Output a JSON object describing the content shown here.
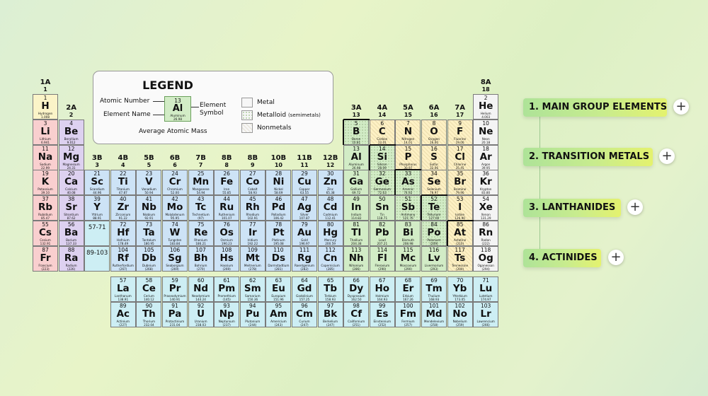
{
  "legend": {
    "title": "LEGEND",
    "atomic_number_label": "Atomic Number",
    "element_name_label": "Element Name",
    "element_symbol_label_1": "Element",
    "element_symbol_label_2": "Symbol",
    "average_mass_label": "Average Atomic Mass",
    "sample": {
      "number": "13",
      "symbol": "Al",
      "name": "Aluminum",
      "mass": "26.98"
    },
    "types": [
      {
        "label": "Metal",
        "note": ""
      },
      {
        "label": "Metalloid",
        "note": "(semimetals)"
      },
      {
        "label": "Nonmetals",
        "note": ""
      }
    ]
  },
  "menu": [
    {
      "label": "1. MAIN GROUP ELEMENTS"
    },
    {
      "label": "2. TRANSITION METALS"
    },
    {
      "label": "3. LANTHANIDES"
    },
    {
      "label": "4. ACTINIDES"
    }
  ],
  "plus_symbol": "+",
  "groups": [
    {
      "a": "1A",
      "n": "1",
      "col": 1
    },
    {
      "a": "2A",
      "n": "2",
      "col": 2
    },
    {
      "a": "3B",
      "n": "3",
      "col": 3
    },
    {
      "a": "4B",
      "n": "4",
      "col": 4
    },
    {
      "a": "5B",
      "n": "5",
      "col": 5
    },
    {
      "a": "6B",
      "n": "6",
      "col": 6
    },
    {
      "a": "7B",
      "n": "7",
      "col": 7
    },
    {
      "a": "8B",
      "n": "8",
      "col": 8
    },
    {
      "a": "8B",
      "n": "9",
      "col": 9
    },
    {
      "a": "10B",
      "n": "10",
      "col": 10
    },
    {
      "a": "11B",
      "n": "11",
      "col": 11
    },
    {
      "a": "12B",
      "n": "12",
      "col": 12
    },
    {
      "a": "3A",
      "n": "13",
      "col": 13
    },
    {
      "a": "4A",
      "n": "14",
      "col": 14
    },
    {
      "a": "5A",
      "n": "15",
      "col": 15
    },
    {
      "a": "6A",
      "n": "16",
      "col": 16
    },
    {
      "a": "7A",
      "n": "17",
      "col": 17
    },
    {
      "a": "8A",
      "n": "18",
      "col": 18
    }
  ],
  "placeholders": [
    {
      "label": "57-71",
      "row": 6,
      "col": 3
    },
    {
      "label": "89-103",
      "row": 7,
      "col": 3
    }
  ],
  "elements": [
    {
      "n": "1",
      "s": "H",
      "name": "Hydrogen",
      "m": "1.008",
      "r": 1,
      "c": 1,
      "cat": "h"
    },
    {
      "n": "2",
      "s": "He",
      "name": "Helium",
      "m": "4.003",
      "r": 1,
      "c": 18,
      "cat": "noble"
    },
    {
      "n": "3",
      "s": "Li",
      "name": "Lithium",
      "m": "6.941",
      "r": 2,
      "c": 1,
      "cat": "alkali"
    },
    {
      "n": "4",
      "s": "Be",
      "name": "Beryllium",
      "m": "9.012",
      "r": 2,
      "c": 2,
      "cat": "alkaline"
    },
    {
      "n": "5",
      "s": "B",
      "name": "Boron",
      "m": "10.81",
      "r": 2,
      "c": 13,
      "cat": "metalloid"
    },
    {
      "n": "6",
      "s": "C",
      "name": "Carbon",
      "m": "12.01",
      "r": 2,
      "c": 14,
      "cat": "nonmetal"
    },
    {
      "n": "7",
      "s": "N",
      "name": "Nitrogen",
      "m": "14.01",
      "r": 2,
      "c": 15,
      "cat": "nonmetal"
    },
    {
      "n": "8",
      "s": "O",
      "name": "Oxygen",
      "m": "16.00",
      "r": 2,
      "c": 16,
      "cat": "nonmetal"
    },
    {
      "n": "9",
      "s": "F",
      "name": "Fluorine",
      "m": "19.00",
      "r": 2,
      "c": 17,
      "cat": "nonmetal"
    },
    {
      "n": "10",
      "s": "Ne",
      "name": "Neon",
      "m": "20.18",
      "r": 2,
      "c": 18,
      "cat": "noble"
    },
    {
      "n": "11",
      "s": "Na",
      "name": "Sodium",
      "m": "22.99",
      "r": 3,
      "c": 1,
      "cat": "alkali"
    },
    {
      "n": "12",
      "s": "Mg",
      "name": "Magnesium",
      "m": "24.31",
      "r": 3,
      "c": 2,
      "cat": "alkaline"
    },
    {
      "n": "13",
      "s": "Al",
      "name": "Aluminum",
      "m": "26.98",
      "r": 3,
      "c": 13,
      "cat": "post"
    },
    {
      "n": "14",
      "s": "Si",
      "name": "Silicon",
      "m": "28.09",
      "r": 3,
      "c": 14,
      "cat": "metalloid"
    },
    {
      "n": "15",
      "s": "P",
      "name": "Phosphorus",
      "m": "30.97",
      "r": 3,
      "c": 15,
      "cat": "nonmetal"
    },
    {
      "n": "16",
      "s": "S",
      "name": "Sulfur",
      "m": "32.06",
      "r": 3,
      "c": 16,
      "cat": "nonmetal"
    },
    {
      "n": "17",
      "s": "Cl",
      "name": "Chlorine",
      "m": "35.45",
      "r": 3,
      "c": 17,
      "cat": "nonmetal"
    },
    {
      "n": "18",
      "s": "Ar",
      "name": "Argon",
      "m": "39.95",
      "r": 3,
      "c": 18,
      "cat": "noble"
    },
    {
      "n": "19",
      "s": "K",
      "name": "Potassium",
      "m": "39.10",
      "r": 4,
      "c": 1,
      "cat": "alkali"
    },
    {
      "n": "20",
      "s": "Ca",
      "name": "Calcium",
      "m": "40.08",
      "r": 4,
      "c": 2,
      "cat": "alkaline"
    },
    {
      "n": "21",
      "s": "Sc",
      "name": "Scandium",
      "m": "44.96",
      "r": 4,
      "c": 3,
      "cat": "transition"
    },
    {
      "n": "22",
      "s": "Ti",
      "name": "Titanium",
      "m": "47.87",
      "r": 4,
      "c": 4,
      "cat": "transition"
    },
    {
      "n": "23",
      "s": "V",
      "name": "Vanadium",
      "m": "50.94",
      "r": 4,
      "c": 5,
      "cat": "transition"
    },
    {
      "n": "24",
      "s": "Cr",
      "name": "Chromium",
      "m": "52.00",
      "r": 4,
      "c": 6,
      "cat": "transition"
    },
    {
      "n": "25",
      "s": "Mn",
      "name": "Manganese",
      "m": "54.94",
      "r": 4,
      "c": 7,
      "cat": "transition"
    },
    {
      "n": "26",
      "s": "Fe",
      "name": "Iron",
      "m": "55.85",
      "r": 4,
      "c": 8,
      "cat": "transition"
    },
    {
      "n": "27",
      "s": "Co",
      "name": "Cobalt",
      "m": "58.93",
      "r": 4,
      "c": 9,
      "cat": "transition"
    },
    {
      "n": "28",
      "s": "Ni",
      "name": "Nickel",
      "m": "58.69",
      "r": 4,
      "c": 10,
      "cat": "transition"
    },
    {
      "n": "29",
      "s": "Cu",
      "name": "Copper",
      "m": "63.55",
      "r": 4,
      "c": 11,
      "cat": "transition"
    },
    {
      "n": "30",
      "s": "Zn",
      "name": "Zinc",
      "m": "65.38",
      "r": 4,
      "c": 12,
      "cat": "transition"
    },
    {
      "n": "31",
      "s": "Ga",
      "name": "Gallium",
      "m": "69.72",
      "r": 4,
      "c": 13,
      "cat": "post"
    },
    {
      "n": "32",
      "s": "Ge",
      "name": "Germanium",
      "m": "72.63",
      "r": 4,
      "c": 14,
      "cat": "metalloid"
    },
    {
      "n": "33",
      "s": "As",
      "name": "Arsenic",
      "m": "74.92",
      "r": 4,
      "c": 15,
      "cat": "metalloid"
    },
    {
      "n": "34",
      "s": "Se",
      "name": "Selenium",
      "m": "78.97",
      "r": 4,
      "c": 16,
      "cat": "nonmetal"
    },
    {
      "n": "35",
      "s": "Br",
      "name": "Bromine",
      "m": "79.90",
      "r": 4,
      "c": 17,
      "cat": "nonmetal"
    },
    {
      "n": "36",
      "s": "Kr",
      "name": "Krypton",
      "m": "83.80",
      "r": 4,
      "c": 18,
      "cat": "noble"
    },
    {
      "n": "37",
      "s": "Rb",
      "name": "Rubidium",
      "m": "85.47",
      "r": 5,
      "c": 1,
      "cat": "alkali"
    },
    {
      "n": "38",
      "s": "Sr",
      "name": "Strontium",
      "m": "87.62",
      "r": 5,
      "c": 2,
      "cat": "alkaline"
    },
    {
      "n": "39",
      "s": "Y",
      "name": "Yttrium",
      "m": "88.91",
      "r": 5,
      "c": 3,
      "cat": "transition"
    },
    {
      "n": "40",
      "s": "Zr",
      "name": "Zirconium",
      "m": "91.22",
      "r": 5,
      "c": 4,
      "cat": "transition"
    },
    {
      "n": "41",
      "s": "Nb",
      "name": "Niobium",
      "m": "92.91",
      "r": 5,
      "c": 5,
      "cat": "transition"
    },
    {
      "n": "42",
      "s": "Mo",
      "name": "Molybdenum",
      "m": "95.95",
      "r": 5,
      "c": 6,
      "cat": "transition"
    },
    {
      "n": "43",
      "s": "Tc",
      "name": "Technetium",
      "m": "(97)",
      "r": 5,
      "c": 7,
      "cat": "transition"
    },
    {
      "n": "44",
      "s": "Ru",
      "name": "Ruthenium",
      "m": "101.07",
      "r": 5,
      "c": 8,
      "cat": "transition"
    },
    {
      "n": "45",
      "s": "Rh",
      "name": "Rhodium",
      "m": "102.91",
      "r": 5,
      "c": 9,
      "cat": "transition"
    },
    {
      "n": "46",
      "s": "Pd",
      "name": "Palladium",
      "m": "106.42",
      "r": 5,
      "c": 10,
      "cat": "transition"
    },
    {
      "n": "47",
      "s": "Ag",
      "name": "Silver",
      "m": "107.87",
      "r": 5,
      "c": 11,
      "cat": "transition"
    },
    {
      "n": "48",
      "s": "Cd",
      "name": "Cadmium",
      "m": "112.41",
      "r": 5,
      "c": 12,
      "cat": "transition"
    },
    {
      "n": "49",
      "s": "In",
      "name": "Indium",
      "m": "114.82",
      "r": 5,
      "c": 13,
      "cat": "post"
    },
    {
      "n": "50",
      "s": "Sn",
      "name": "Tin",
      "m": "118.71",
      "r": 5,
      "c": 14,
      "cat": "post"
    },
    {
      "n": "51",
      "s": "Sb",
      "name": "Antimony",
      "m": "121.76",
      "r": 5,
      "c": 15,
      "cat": "metalloid"
    },
    {
      "n": "52",
      "s": "Te",
      "name": "Tellurium",
      "m": "127.60",
      "r": 5,
      "c": 16,
      "cat": "metalloid"
    },
    {
      "n": "53",
      "s": "I",
      "name": "Iodine",
      "m": "126.90",
      "r": 5,
      "c": 17,
      "cat": "nonmetal"
    },
    {
      "n": "54",
      "s": "Xe",
      "name": "Xenon",
      "m": "131.29",
      "r": 5,
      "c": 18,
      "cat": "noble"
    },
    {
      "n": "55",
      "s": "Cs",
      "name": "Cesium",
      "m": "132.91",
      "r": 6,
      "c": 1,
      "cat": "alkali"
    },
    {
      "n": "56",
      "s": "Ba",
      "name": "Barium",
      "m": "137.33",
      "r": 6,
      "c": 2,
      "cat": "alkaline"
    },
    {
      "n": "72",
      "s": "Hf",
      "name": "Hafnium",
      "m": "178.49",
      "r": 6,
      "c": 4,
      "cat": "transition"
    },
    {
      "n": "73",
      "s": "Ta",
      "name": "Tantalum",
      "m": "180.95",
      "r": 6,
      "c": 5,
      "cat": "transition"
    },
    {
      "n": "74",
      "s": "W",
      "name": "Tungsten",
      "m": "183.84",
      "r": 6,
      "c": 6,
      "cat": "transition"
    },
    {
      "n": "75",
      "s": "Re",
      "name": "Rhenium",
      "m": "186.21",
      "r": 6,
      "c": 7,
      "cat": "transition"
    },
    {
      "n": "76",
      "s": "Os",
      "name": "Osmium",
      "m": "190.23",
      "r": 6,
      "c": 8,
      "cat": "transition"
    },
    {
      "n": "77",
      "s": "Ir",
      "name": "Iridium",
      "m": "192.22",
      "r": 6,
      "c": 9,
      "cat": "transition"
    },
    {
      "n": "78",
      "s": "Pt",
      "name": "Platinum",
      "m": "195.08",
      "r": 6,
      "c": 10,
      "cat": "transition"
    },
    {
      "n": "79",
      "s": "Au",
      "name": "Gold",
      "m": "196.97",
      "r": 6,
      "c": 11,
      "cat": "transition"
    },
    {
      "n": "80",
      "s": "Hg",
      "name": "Mercury",
      "m": "200.59",
      "r": 6,
      "c": 12,
      "cat": "transition"
    },
    {
      "n": "81",
      "s": "Tl",
      "name": "Thallium",
      "m": "204.38",
      "r": 6,
      "c": 13,
      "cat": "post"
    },
    {
      "n": "82",
      "s": "Pb",
      "name": "Lead",
      "m": "207.21",
      "r": 6,
      "c": 14,
      "cat": "post"
    },
    {
      "n": "83",
      "s": "Bi",
      "name": "Bismuth",
      "m": "208.98",
      "r": 6,
      "c": 15,
      "cat": "post"
    },
    {
      "n": "84",
      "s": "Po",
      "name": "Polonium",
      "m": "(209)",
      "r": 6,
      "c": 16,
      "cat": "metalloid"
    },
    {
      "n": "85",
      "s": "At",
      "name": "Astatine",
      "m": "(210)",
      "r": 6,
      "c": 17,
      "cat": "nonmetal"
    },
    {
      "n": "86",
      "s": "Rn",
      "name": "Radon",
      "m": "(222)",
      "r": 6,
      "c": 18,
      "cat": "noble"
    },
    {
      "n": "87",
      "s": "Fr",
      "name": "Francium",
      "m": "(223)",
      "r": 7,
      "c": 1,
      "cat": "alkali"
    },
    {
      "n": "88",
      "s": "Ra",
      "name": "Radium",
      "m": "(226)",
      "r": 7,
      "c": 2,
      "cat": "alkaline"
    },
    {
      "n": "104",
      "s": "Rf",
      "name": "Rutherfordium",
      "m": "(267)",
      "r": 7,
      "c": 4,
      "cat": "transition"
    },
    {
      "n": "105",
      "s": "Db",
      "name": "Dubnium",
      "m": "(268)",
      "r": 7,
      "c": 5,
      "cat": "transition"
    },
    {
      "n": "106",
      "s": "Sg",
      "name": "Seaborgium",
      "m": "(269)",
      "r": 7,
      "c": 6,
      "cat": "transition"
    },
    {
      "n": "107",
      "s": "Bh",
      "name": "Bohrium",
      "m": "(270)",
      "r": 7,
      "c": 7,
      "cat": "transition"
    },
    {
      "n": "108",
      "s": "Hs",
      "name": "Hassium",
      "m": "(269)",
      "r": 7,
      "c": 8,
      "cat": "transition"
    },
    {
      "n": "109",
      "s": "Mt",
      "name": "Meitnerium",
      "m": "(278)",
      "r": 7,
      "c": 9,
      "cat": "transition"
    },
    {
      "n": "110",
      "s": "Ds",
      "name": "Darmstadtium",
      "m": "(281)",
      "r": 7,
      "c": 10,
      "cat": "transition"
    },
    {
      "n": "111",
      "s": "Rg",
      "name": "Roentgenium",
      "m": "(282)",
      "r": 7,
      "c": 11,
      "cat": "transition"
    },
    {
      "n": "112",
      "s": "Cn",
      "name": "Copernicium",
      "m": "(285)",
      "r": 7,
      "c": 12,
      "cat": "transition"
    },
    {
      "n": "113",
      "s": "Nh",
      "name": "Nihonium",
      "m": "(286)",
      "r": 7,
      "c": 13,
      "cat": "post"
    },
    {
      "n": "114",
      "s": "Fl",
      "name": "Flerovium",
      "m": "(290)",
      "r": 7,
      "c": 14,
      "cat": "post"
    },
    {
      "n": "115",
      "s": "Mc",
      "name": "Moscovium",
      "m": "(290)",
      "r": 7,
      "c": 15,
      "cat": "post"
    },
    {
      "n": "116",
      "s": "Lv",
      "name": "Livermorium",
      "m": "(293)",
      "r": 7,
      "c": 16,
      "cat": "post"
    },
    {
      "n": "117",
      "s": "Ts",
      "name": "Tennessine",
      "m": "(294)",
      "r": 7,
      "c": 17,
      "cat": "nonmetal"
    },
    {
      "n": "118",
      "s": "Og",
      "name": "Oganesson",
      "m": "(294)",
      "r": 7,
      "c": 18,
      "cat": "noble"
    },
    {
      "n": "57",
      "s": "La",
      "name": "Lanthanum",
      "m": "138.91",
      "r": 9,
      "c": 4,
      "cat": "lanth"
    },
    {
      "n": "58",
      "s": "Ce",
      "name": "Cerium",
      "m": "140.12",
      "r": 9,
      "c": 5,
      "cat": "lanth"
    },
    {
      "n": "59",
      "s": "Pr",
      "name": "Praseodymium",
      "m": "140.91",
      "r": 9,
      "c": 6,
      "cat": "lanth"
    },
    {
      "n": "60",
      "s": "Nd",
      "name": "Neodymium",
      "m": "144.24",
      "r": 9,
      "c": 7,
      "cat": "lanth"
    },
    {
      "n": "61",
      "s": "Pm",
      "name": "Promethium",
      "m": "(145)",
      "r": 9,
      "c": 8,
      "cat": "lanth"
    },
    {
      "n": "62",
      "s": "Sm",
      "name": "Samarium",
      "m": "150.36",
      "r": 9,
      "c": 9,
      "cat": "lanth"
    },
    {
      "n": "63",
      "s": "Eu",
      "name": "Europium",
      "m": "151.96",
      "r": 9,
      "c": 10,
      "cat": "lanth"
    },
    {
      "n": "64",
      "s": "Gd",
      "name": "Gadolinium",
      "m": "157.25",
      "r": 9,
      "c": 11,
      "cat": "lanth"
    },
    {
      "n": "65",
      "s": "Tb",
      "name": "Terbium",
      "m": "158.93",
      "r": 9,
      "c": 12,
      "cat": "lanth"
    },
    {
      "n": "66",
      "s": "Dy",
      "name": "Dysprosium",
      "m": "162.50",
      "r": 9,
      "c": 13,
      "cat": "lanth"
    },
    {
      "n": "67",
      "s": "Ho",
      "name": "Holmium",
      "m": "164.93",
      "r": 9,
      "c": 14,
      "cat": "lanth"
    },
    {
      "n": "68",
      "s": "Er",
      "name": "Erbium",
      "m": "167.26",
      "r": 9,
      "c": 15,
      "cat": "lanth"
    },
    {
      "n": "69",
      "s": "Tm",
      "name": "Thulium",
      "m": "168.93",
      "r": 9,
      "c": 16,
      "cat": "lanth"
    },
    {
      "n": "70",
      "s": "Yb",
      "name": "Ytterbium",
      "m": "173.05",
      "r": 9,
      "c": 17,
      "cat": "lanth"
    },
    {
      "n": "71",
      "s": "Lu",
      "name": "Lutetium",
      "m": "174.97",
      "r": 9,
      "c": 18,
      "cat": "lanth"
    },
    {
      "n": "89",
      "s": "Ac",
      "name": "Actinium",
      "m": "(227)",
      "r": 10,
      "c": 4,
      "cat": "actin"
    },
    {
      "n": "90",
      "s": "Th",
      "name": "Thorium",
      "m": "232.04",
      "r": 10,
      "c": 5,
      "cat": "actin"
    },
    {
      "n": "91",
      "s": "Pa",
      "name": "Protactinium",
      "m": "231.04",
      "r": 10,
      "c": 6,
      "cat": "actin"
    },
    {
      "n": "92",
      "s": "U",
      "name": "Uranium",
      "m": "238.03",
      "r": 10,
      "c": 7,
      "cat": "actin"
    },
    {
      "n": "93",
      "s": "Np",
      "name": "Neptunium",
      "m": "(237)",
      "r": 10,
      "c": 8,
      "cat": "actin"
    },
    {
      "n": "94",
      "s": "Pu",
      "name": "Plutonium",
      "m": "(244)",
      "r": 10,
      "c": 9,
      "cat": "actin"
    },
    {
      "n": "95",
      "s": "Am",
      "name": "Americium",
      "m": "(243)",
      "r": 10,
      "c": 10,
      "cat": "actin"
    },
    {
      "n": "96",
      "s": "Cm",
      "name": "Curium",
      "m": "(247)",
      "r": 10,
      "c": 11,
      "cat": "actin"
    },
    {
      "n": "97",
      "s": "Bk",
      "name": "Berkelium",
      "m": "(247)",
      "r": 10,
      "c": 12,
      "cat": "actin"
    },
    {
      "n": "98",
      "s": "Cf",
      "name": "Californium",
      "m": "(251)",
      "r": 10,
      "c": 13,
      "cat": "actin"
    },
    {
      "n": "99",
      "s": "Es",
      "name": "Einsteinium",
      "m": "(252)",
      "r": 10,
      "c": 14,
      "cat": "actin"
    },
    {
      "n": "100",
      "s": "Fm",
      "name": "Fermium",
      "m": "(257)",
      "r": 10,
      "c": 15,
      "cat": "actin"
    },
    {
      "n": "101",
      "s": "Md",
      "name": "Mendelevium",
      "m": "(258)",
      "r": 10,
      "c": 16,
      "cat": "actin"
    },
    {
      "n": "102",
      "s": "No",
      "name": "Nobelium",
      "m": "(259)",
      "r": 10,
      "c": 17,
      "cat": "actin"
    },
    {
      "n": "103",
      "s": "Lr",
      "name": "Lawrencium",
      "m": "(266)",
      "r": 10,
      "c": 18,
      "cat": "actin"
    }
  ]
}
